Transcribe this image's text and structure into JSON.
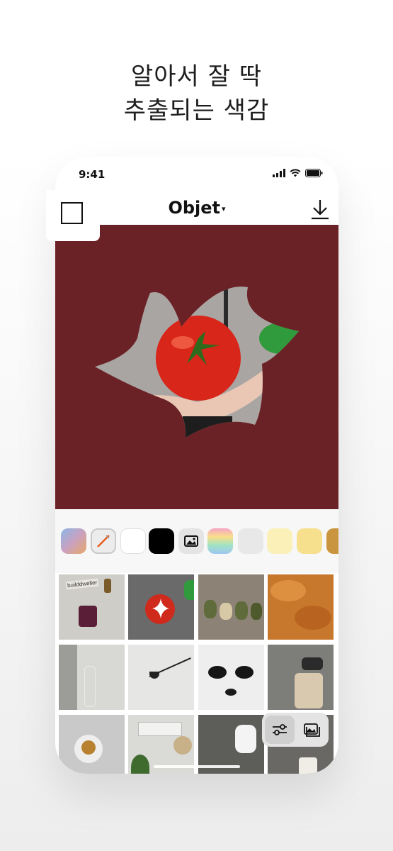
{
  "headline": {
    "line1": "알아서 잘 딱",
    "line2": "추출되는 색감"
  },
  "status_bar": {
    "time": "9:41",
    "icons": [
      "signal-icon",
      "wifi-icon",
      "battery-icon"
    ]
  },
  "nav": {
    "title": "Objet",
    "title_caret": "▾",
    "download_icon": "download-icon",
    "frame_icon": "square-frame-icon"
  },
  "canvas": {
    "background_color": "#6b2226",
    "subject": "tomato held in hand inside star-shaped cutout"
  },
  "palette": {
    "swatches": [
      {
        "name": "gradient-blue-orange",
        "color": "#b9a3c8"
      },
      {
        "name": "eyedropper",
        "color": "#ececec",
        "icon": "eyedropper-icon"
      },
      {
        "name": "white",
        "color": "#ffffff"
      },
      {
        "name": "black",
        "color": "#000000"
      },
      {
        "name": "photo",
        "color": "#e4e4e4",
        "icon": "image-icon"
      },
      {
        "name": "rainbow-gradient",
        "color": "#f8b0c8"
      },
      {
        "name": "light-gray",
        "color": "#e8e8e8"
      },
      {
        "name": "pale-yellow",
        "color": "#fbf0b8"
      },
      {
        "name": "yellow",
        "color": "#f6e08e"
      },
      {
        "name": "mustard",
        "color": "#c9963f"
      }
    ]
  },
  "gallery": {
    "tiles": [
      {
        "name": "photo-jar-desk",
        "color": "#cfcdc8",
        "label": "builddweller"
      },
      {
        "name": "photo-tomato-selected",
        "color": "#6a6a6a",
        "selected_icon": "sparkle-icon"
      },
      {
        "name": "photo-stones-grill",
        "color": "#8c8275"
      },
      {
        "name": "photo-croissants",
        "color": "#c8782c"
      },
      {
        "name": "photo-glass-vase",
        "color": "#b8b8b4"
      },
      {
        "name": "photo-wall-lamp",
        "color": "#e6e6e4"
      },
      {
        "name": "photo-dog-sunglasses",
        "color": "#eeeeee"
      },
      {
        "name": "photo-legs-crosswalk",
        "color": "#7d7d7a"
      },
      {
        "name": "photo-dessert-plate",
        "color": "#c9c9c9"
      },
      {
        "name": "photo-kitchen-plant",
        "color": "#dadad6"
      },
      {
        "name": "photo-sneakers-street",
        "color": "#5d5d5a"
      },
      {
        "name": "photo-coffee-cup",
        "color": "#6a6864"
      }
    ]
  },
  "floating_toggle": {
    "left_icon": "adjust-sliders-icon",
    "right_icon": "gallery-icon"
  }
}
